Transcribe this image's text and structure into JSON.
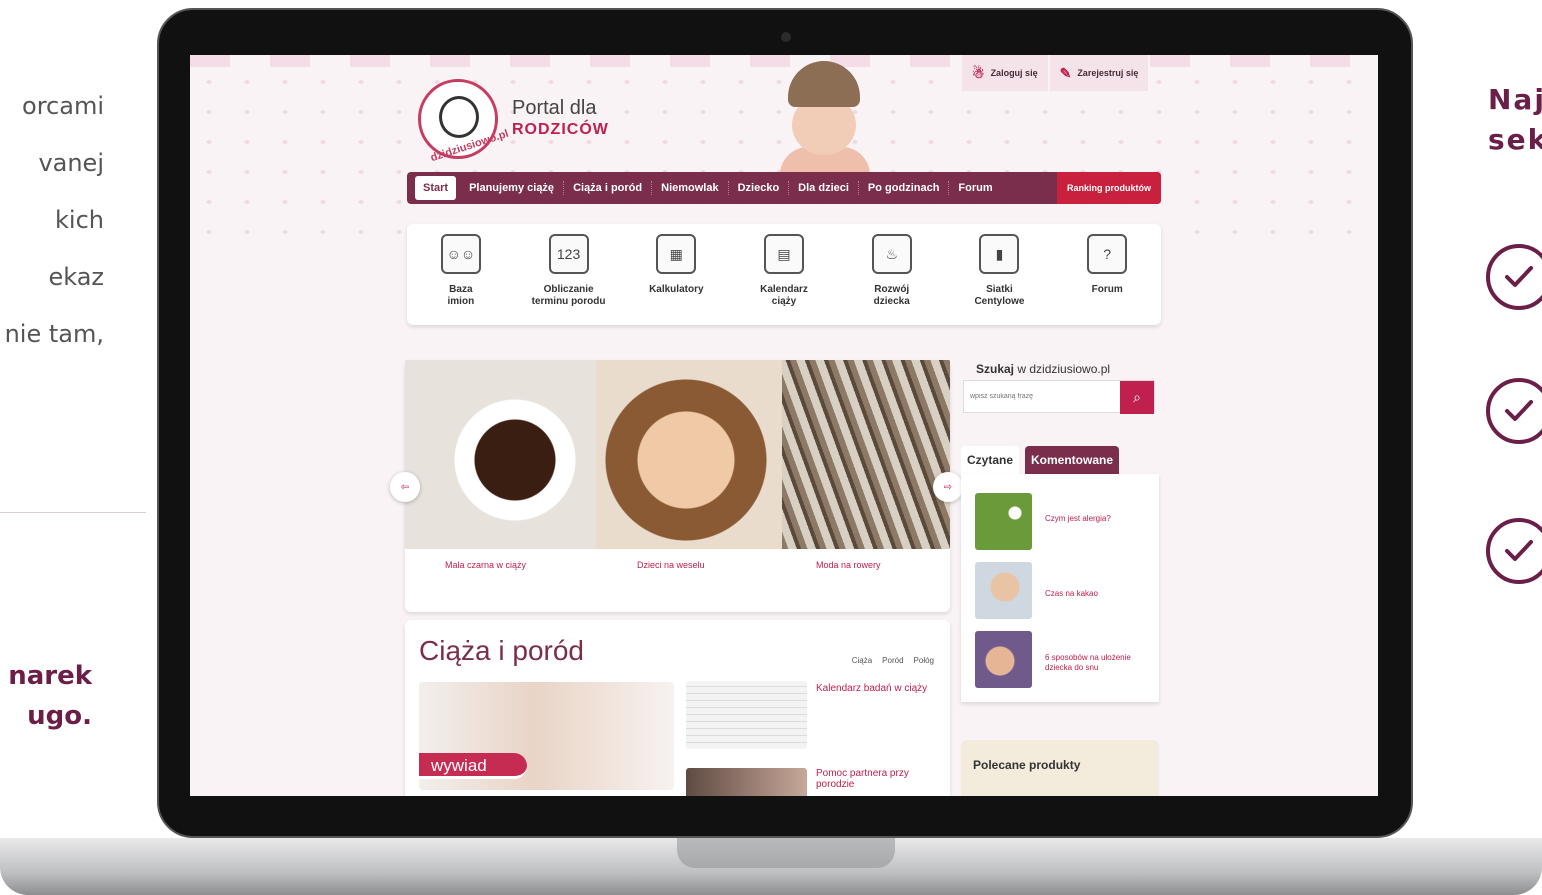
{
  "slide": {
    "left_text_lines": [
      "orcami",
      "vanej",
      "kich",
      "ekaz",
      "nie tam,"
    ],
    "left_bold_lines": [
      "narek",
      "ugo."
    ],
    "right_heading_lines": [
      "Naj",
      "sek"
    ]
  },
  "header": {
    "logo_text": "dzidziusiowo.pl",
    "portal_line1": "Portal dla",
    "portal_line2": "RODZICÓW",
    "login": "Zaloguj się",
    "register": "Zarejestruj się"
  },
  "nav": {
    "items": [
      "Start",
      "Planujemy ciążę",
      "Ciąża i poród",
      "Niemowlak",
      "Dziecko",
      "Dla dzieci",
      "Po godzinach",
      "Forum"
    ],
    "ranking": "Ranking produktów"
  },
  "tools": [
    {
      "label": "Baza\nimion",
      "icon": "baby-names-icon",
      "glyph": "☺☺"
    },
    {
      "label": "Obliczanie\nterminu porodu",
      "icon": "calculator-date-icon",
      "glyph": "123"
    },
    {
      "label": "Kalkulatory",
      "icon": "abacus-icon",
      "glyph": "▦"
    },
    {
      "label": "Kalendarz\nciąży",
      "icon": "calendar-book-icon",
      "glyph": "▤"
    },
    {
      "label": "Rozwój\ndziecka",
      "icon": "cake-icon",
      "glyph": "♨"
    },
    {
      "label": "Siatki\nCentylowe",
      "icon": "growth-chart-icon",
      "glyph": "▮"
    },
    {
      "label": "Forum",
      "icon": "forum-question-icon",
      "glyph": "?"
    }
  ],
  "slider": {
    "captions": [
      "Mala czarna w ciąży",
      "Dzieci na weselu",
      "Moda na rowery"
    ],
    "prev_arrow": "⇦",
    "next_arrow": "⇨"
  },
  "search": {
    "title_bold": "Szukaj",
    "title_rest": " w dzidziusiowo.pl",
    "placeholder": "wpisz szukaną frazę",
    "icon": "search-icon"
  },
  "tabs": {
    "active": "Czytane",
    "inactive": "Komentowane"
  },
  "articles": [
    "Czym jest alergia?",
    "Czas na kakao",
    "6 sposobów na ułożenie dziecka do snu"
  ],
  "recommended": "Polecane produkty",
  "pregnancy": {
    "title": "Ciąża i poród",
    "links": [
      "Ciąża",
      "Poród",
      "Połóg"
    ],
    "badge": "wywiad",
    "items": [
      "Kalendarz badań w ciąży",
      "Pomoc partnera przy porodzie"
    ]
  },
  "colors": {
    "brand": "#c0204d",
    "plum": "#7b2e4c",
    "slide_accent": "#6b1e47"
  }
}
